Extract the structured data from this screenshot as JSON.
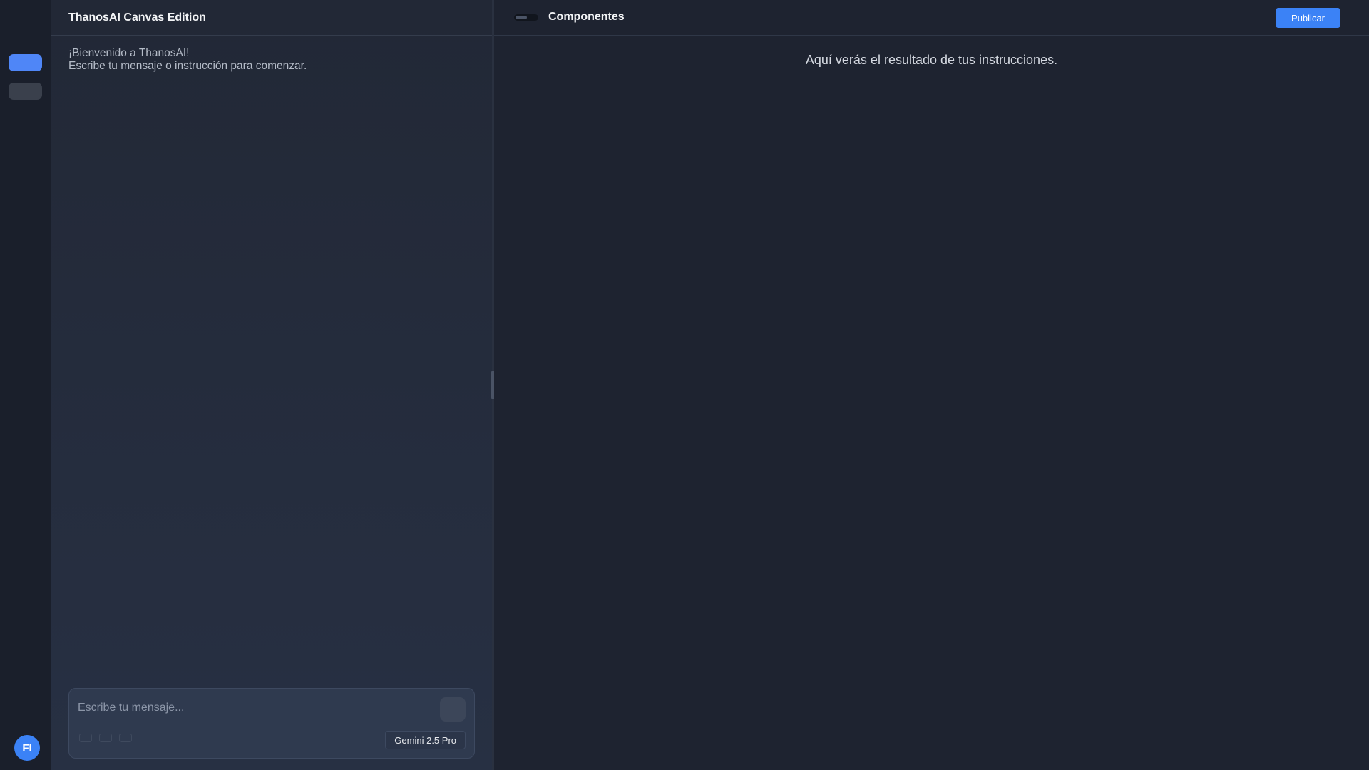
{
  "rail": {
    "avatar_initials": "FI"
  },
  "chat": {
    "title": "ThanosAI Canvas Edition",
    "welcome_line1": "¡Bienvenido a ThanosAI!",
    "welcome_line2": "Escribe tu mensaje o instrucción para comenzar.",
    "composer": {
      "placeholder": "Escribe tu mensaje...",
      "model": "Gemini 2.5 Pro"
    }
  },
  "preview": {
    "title": "Componentes",
    "publish_label": "Publicar",
    "hint": "Aquí verás el resultado de tus instrucciones."
  },
  "colors": {
    "accent": "#3b82f6",
    "background": "#1e2330",
    "panel": "#222836"
  }
}
